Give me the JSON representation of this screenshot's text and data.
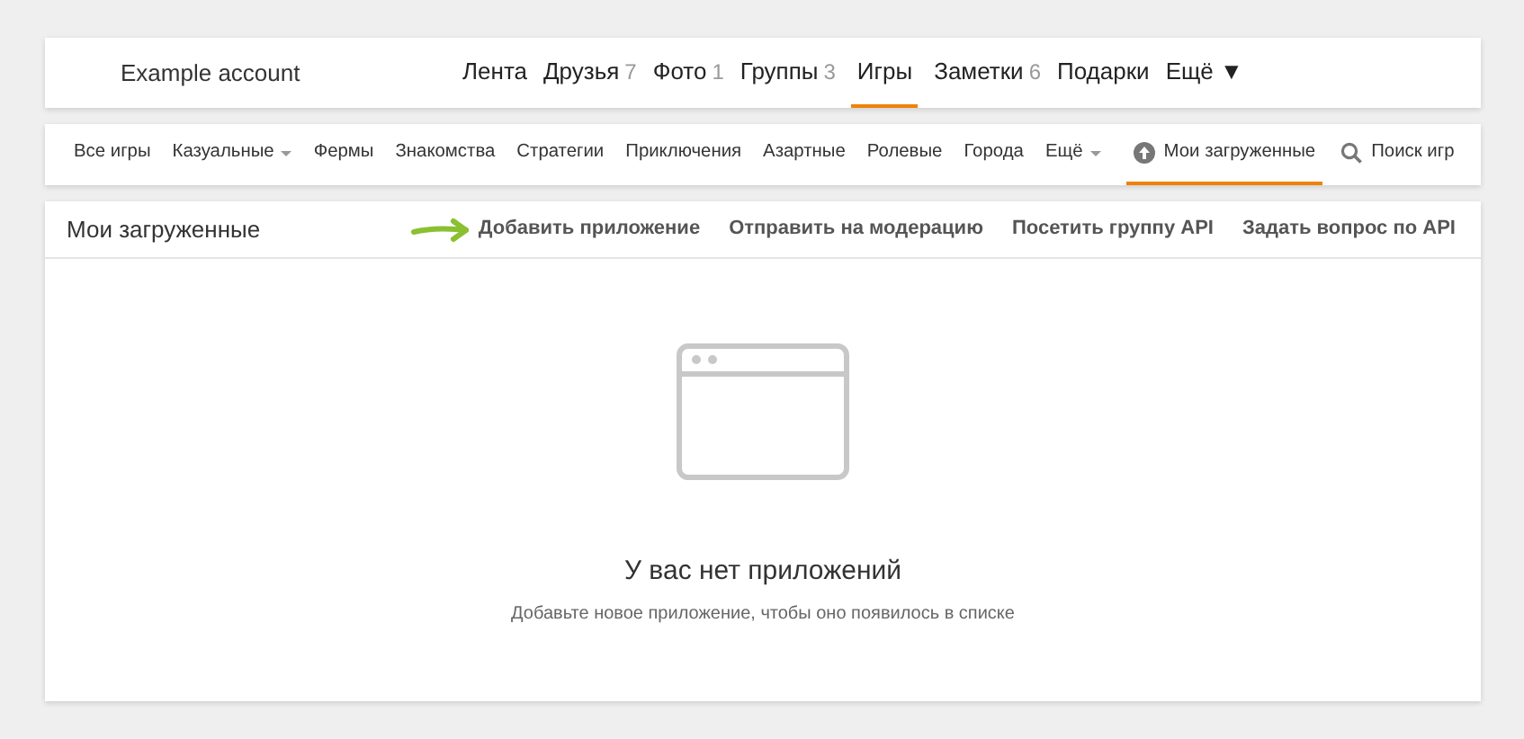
{
  "header": {
    "account": "Example account",
    "nav": [
      {
        "label": "Лента",
        "selected": false
      },
      {
        "label": "Друзья",
        "count": "7",
        "selected": false
      },
      {
        "label": "Фото",
        "count": "1",
        "selected": false
      },
      {
        "label": "Группы",
        "count": "3",
        "selected": false
      },
      {
        "label": "Игры",
        "selected": true
      },
      {
        "label": "Заметки",
        "count": "6",
        "selected": false
      },
      {
        "label": "Подарки",
        "selected": false
      },
      {
        "label": "Ещё ▼",
        "selected": false
      }
    ]
  },
  "categories": {
    "items": [
      {
        "label": "Все игры",
        "dropdown": false
      },
      {
        "label": "Казуальные",
        "dropdown": true
      },
      {
        "label": "Фермы",
        "dropdown": false
      },
      {
        "label": "Знакомства",
        "dropdown": false
      },
      {
        "label": "Стратегии",
        "dropdown": false
      },
      {
        "label": "Приключения",
        "dropdown": false
      },
      {
        "label": "Азартные",
        "dropdown": false
      },
      {
        "label": "Ролевые",
        "dropdown": false
      },
      {
        "label": "Города",
        "dropdown": false
      },
      {
        "label": "Ещё",
        "dropdown": true
      }
    ],
    "tabs": [
      {
        "label": "Мои загруженные",
        "kind": "upload",
        "selected": true
      },
      {
        "label": "Поиск игр",
        "kind": "search",
        "selected": false
      }
    ]
  },
  "panel": {
    "title": "Мои загруженные",
    "actions": [
      {
        "label": "Добавить приложение",
        "arrow": true
      },
      {
        "label": "Отправить на модерацию",
        "arrow": false
      },
      {
        "label": "Посетить группу API",
        "arrow": false
      },
      {
        "label": "Задать вопрос по API",
        "arrow": false
      }
    ],
    "empty": {
      "title": "У вас нет приложений",
      "subtitle": "Добавьте новое приложение, чтобы оно появилось в списке"
    }
  }
}
